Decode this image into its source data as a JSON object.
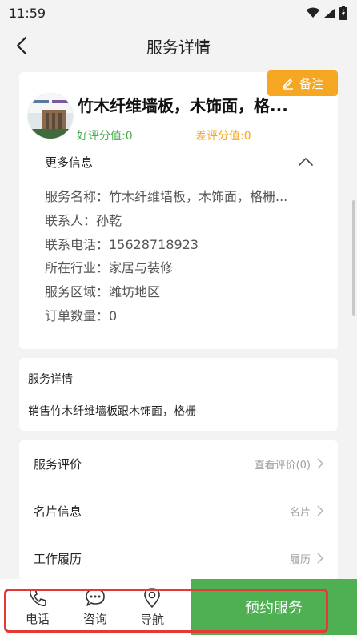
{
  "status_bar": {
    "time": "11:59",
    "icons": [
      "wifi-icon",
      "signal-icon",
      "battery-icon"
    ]
  },
  "header": {
    "title": "服务详情",
    "back_icon": "chevron-left-icon"
  },
  "service": {
    "name": "竹木纤维墙板，木饰面，格...",
    "note_label": "备注",
    "good_rating": "好评分值:0",
    "bad_rating": "差评分值:0",
    "more_info_title": "更多信息",
    "info_rows": [
      "服务名称：竹木纤维墙板，木饰面，格栅...",
      "联系人：孙乾",
      "联系电话：15628718923",
      "所在行业：家居与装修",
      "服务区域：潍坊地区",
      "订单数量：0"
    ]
  },
  "details": {
    "title": "服务详情",
    "text": "销售竹木纤维墙板跟木饰面，格栅"
  },
  "menu": [
    {
      "label": "服务评价",
      "right": "查看评价(0)"
    },
    {
      "label": "名片信息",
      "right": "名片"
    },
    {
      "label": "工作履历",
      "right": "履历"
    }
  ],
  "bottom_bar": {
    "tabs": [
      {
        "label": "电话",
        "icon": "phone-icon"
      },
      {
        "label": "咨询",
        "icon": "chat-icon"
      },
      {
        "label": "导航",
        "icon": "location-pin-icon"
      }
    ],
    "reserve_label": "预约服务"
  },
  "colors": {
    "accent_green": "#4fb053",
    "note_orange": "#f5a623",
    "good_green": "#4caf50",
    "highlight_red": "#e53935"
  }
}
